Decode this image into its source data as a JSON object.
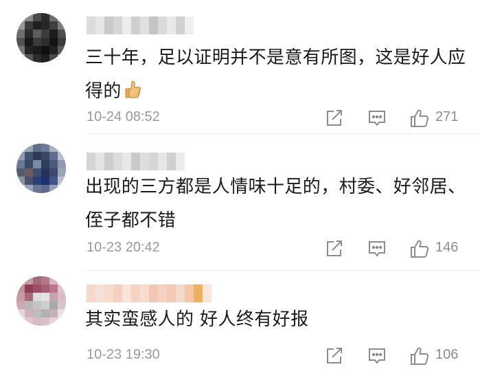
{
  "comments": [
    {
      "text": "三十年，足以证明并不是意有所图，这是好人应得的",
      "emoji": "thumbs-up",
      "time": "10-24 08:52",
      "likes": "271"
    },
    {
      "text": "出现的三方都是人情味十足的，村委、好邻居、侄子都不错",
      "time": "10-23 20:42",
      "likes": "146"
    },
    {
      "text": "其实蛮感人的 好人终有好报",
      "time": "10-23 19:30",
      "likes": "106"
    }
  ],
  "icons": {
    "share": "share-icon",
    "comment": "comment-icon",
    "like": "like-icon"
  },
  "colors": {
    "meta_text": "#9a9a9a",
    "icon": "#8c8c8c",
    "divider": "#ececec"
  }
}
